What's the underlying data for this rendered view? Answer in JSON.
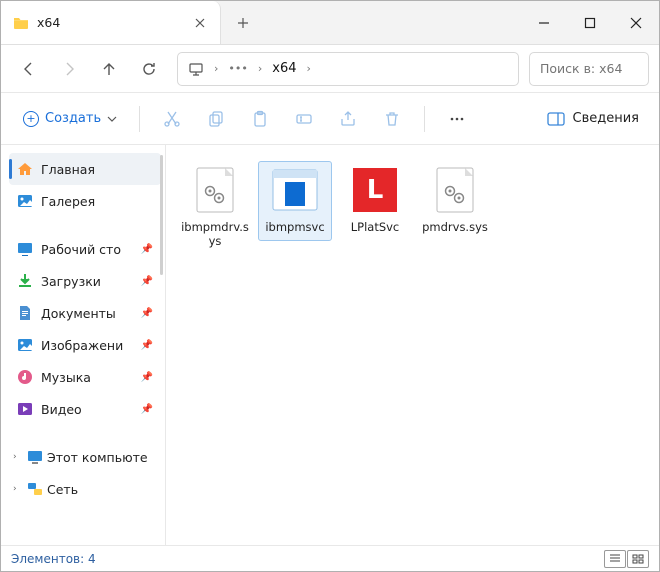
{
  "tab": {
    "title": "x64"
  },
  "address": {
    "crumb": "x64"
  },
  "search": {
    "placeholder": "Поиск в: x64"
  },
  "toolbar": {
    "new_label": "Создать",
    "details_label": "Сведения"
  },
  "sidebar": {
    "home_label": "Главная",
    "gallery_label": "Галерея",
    "desktop_label": "Рабочий сто",
    "downloads_label": "Загрузки",
    "documents_label": "Документы",
    "pictures_label": "Изображени",
    "music_label": "Музыка",
    "videos_label": "Видео",
    "this_pc_label": "Этот компьюте",
    "network_label": "Сеть"
  },
  "files": [
    {
      "name": "ibmpmdrv.sys",
      "kind": "sys",
      "selected": false
    },
    {
      "name": "ibmpmsvc",
      "kind": "exe-blue",
      "selected": true
    },
    {
      "name": "LPlatSvc",
      "kind": "exe-lenovo",
      "selected": false
    },
    {
      "name": "pmdrvs.sys",
      "kind": "sys",
      "selected": false
    }
  ],
  "status": {
    "count_label": "Элементов:",
    "count": "4"
  }
}
